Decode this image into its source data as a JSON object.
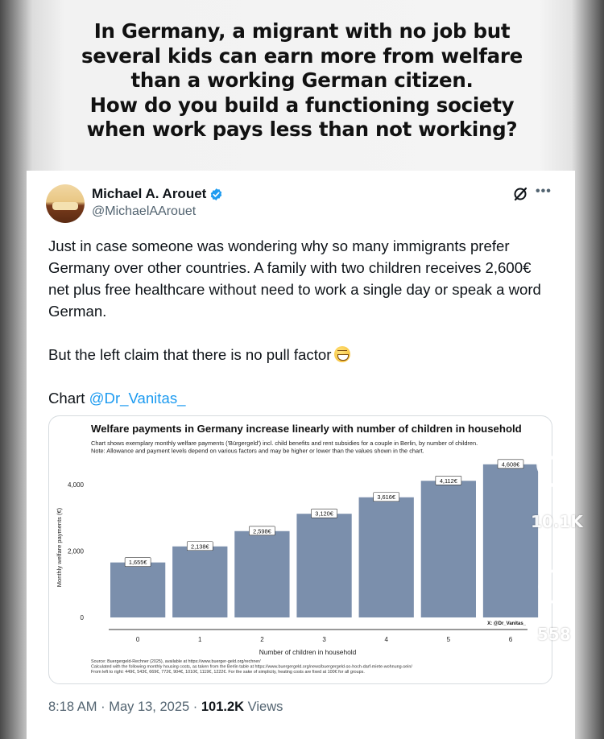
{
  "headline": {
    "lines": [
      "In Germany, a migrant with no job but",
      "several kids can earn more from welfare",
      "than a working German citizen.",
      "How do you build a functioning society",
      "when work pays less than not working?"
    ]
  },
  "tweet": {
    "author_name": "Michael A. Arouet",
    "handle": "@MichaelAArouet",
    "text_p1": "Just in case someone was wondering why so many immigrants prefer Germany over other countries. A family with two children receives 2,600€ net plus free healthcare without need to work a single day or speak a word German.",
    "text_p2": "But the left claim that there is no pull factor",
    "chart_prefix": "Chart",
    "chart_mention": "@Dr_Vanitas_",
    "timestamp": "8:18 AM · May 13, 2025 · ",
    "views_count": "101.2K",
    "views_label": " Views"
  },
  "side": {
    "like_count": "10.1K",
    "comment_count": "558"
  },
  "icons": {
    "verified": "verified-badge-icon",
    "grok": "grok-icon",
    "more": "more-icon",
    "like": "heart-icon",
    "comment": "comment-icon",
    "share": "send-icon"
  },
  "colors": {
    "bar": "#7b8fac",
    "link": "#1d9bf0",
    "muted": "#536471"
  },
  "chart_data": {
    "type": "bar",
    "title": "Welfare payments in Germany increase linearly with number of children in household",
    "subtitle_lines": [
      "Chart shows exemplary monthly welfare payments ('Bürgergeld') incl. child benefits and rent subsidies for a couple in Berlin, by number of children.",
      "Note: Allowance and payment levels depend on various factors and may be higher or lower than the values shown in the chart."
    ],
    "xlabel": "Number of children in household",
    "ylabel": "Monthly welfare payments (€)",
    "categories": [
      "0",
      "1",
      "2",
      "3",
      "4",
      "5",
      "6"
    ],
    "values": [
      1655,
      2138,
      2598,
      3120,
      3616,
      4112,
      4608
    ],
    "value_labels": [
      "1,655€",
      "2,138€",
      "2,598€",
      "3,120€",
      "3,616€",
      "4,112€",
      "4,608€"
    ],
    "yticks": [
      0,
      2000,
      4000
    ],
    "ytick_labels": [
      "0",
      "2,000",
      "4,000"
    ],
    "ylim": [
      0,
      4700
    ],
    "grid": false,
    "watermark": "X: @Dr_Vanitas_",
    "source_lines": [
      "Source: Buergergeld-Rechner (2025), available at https://www.buerger-geld.org/rechner/",
      "Calculated with the following monthly housing costs, as taken from the Berlin table at https://www.buergergeld.org/news/buergergeld-so-hoch-darf-miete-wohnung-sein/",
      "From left to right: 449€, 543€, 669€, 772€, 904€, 1010€, 1119€, 1222€. For the sake of simplicity, heating costs are fixed at 100€ for all groups."
    ]
  }
}
